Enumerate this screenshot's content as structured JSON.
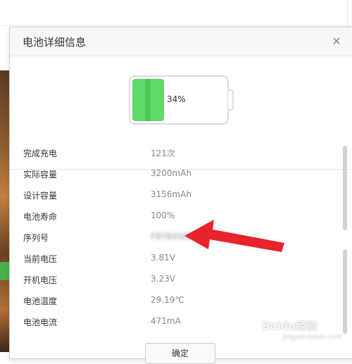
{
  "dialog": {
    "title": "电池详细信息",
    "close_icon": "close-icon"
  },
  "battery": {
    "percent_label": "34%",
    "level": 0.34,
    "fill_color": "#62d96b"
  },
  "info_rows": [
    {
      "label": "完成充电",
      "value": "121次"
    },
    {
      "label": "实际容量",
      "value": "3200mAh"
    },
    {
      "label": "设计容量",
      "value": "3156mAh"
    },
    {
      "label": "电池寿命",
      "value": "100%"
    },
    {
      "label": "序列号",
      "value": "F8Y845EQ6PDJP27A"
    },
    {
      "label": "当前电压",
      "value": "3.81V"
    },
    {
      "label": "开机电压",
      "value": "3.23V"
    },
    {
      "label": "电池温度",
      "value": "29.19℃"
    },
    {
      "label": "电池电流",
      "value": "471mA"
    }
  ],
  "footer": {
    "ok_label": "确定"
  },
  "watermark": {
    "brand": "Baidu经验",
    "url": "jingyan.baidu.com"
  },
  "colors": {
    "annotation_arrow": "#e8232b"
  }
}
